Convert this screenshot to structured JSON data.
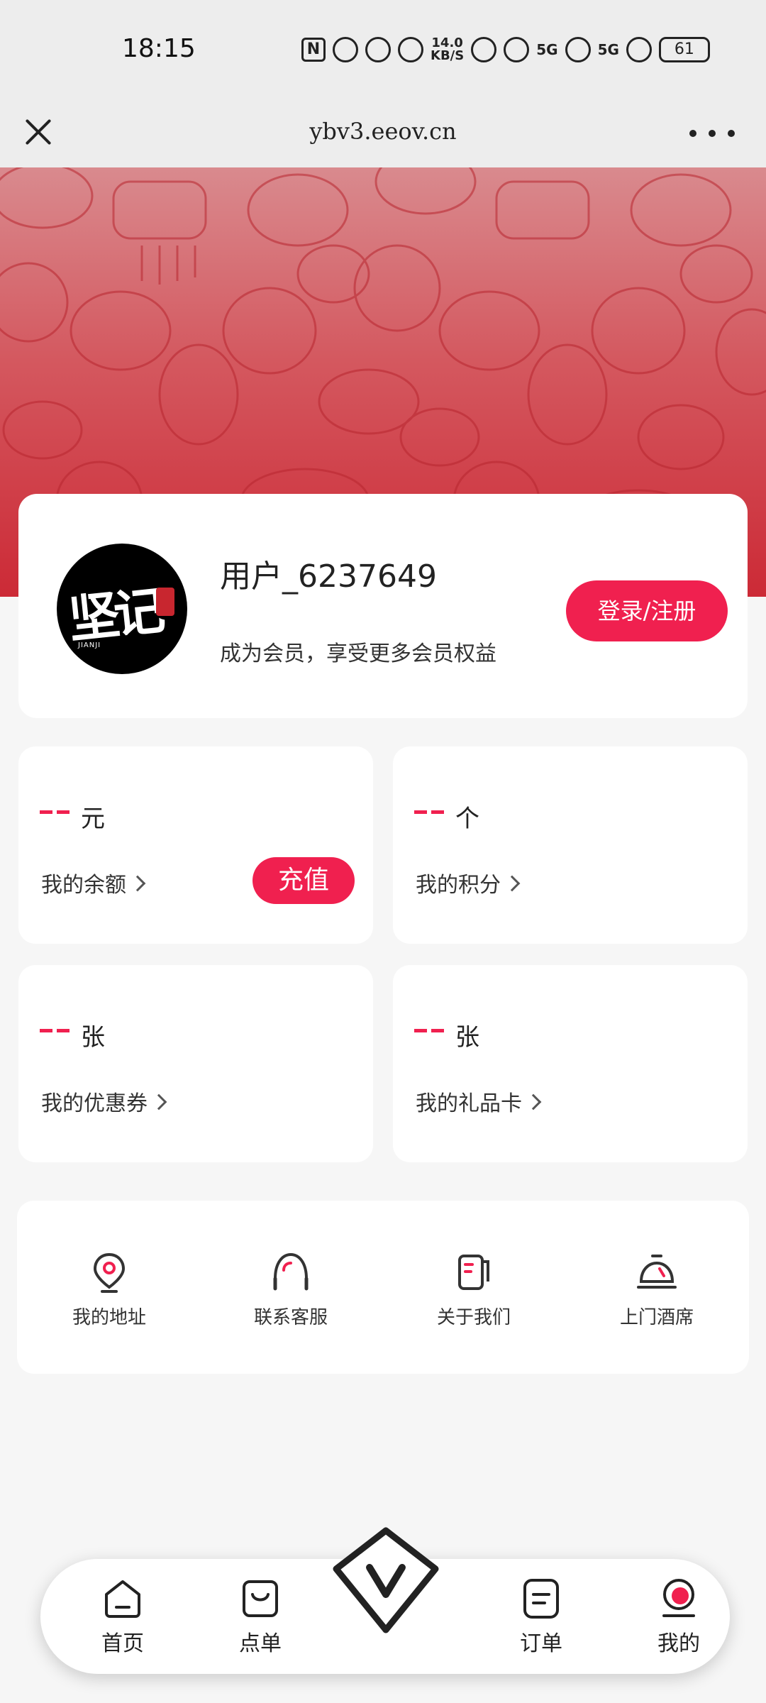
{
  "status_bar": {
    "time": "18:15",
    "net_speed_value": "14.0",
    "net_speed_unit": "KB/S",
    "signal_1": "5G",
    "signal_2": "5G",
    "battery": "61"
  },
  "title_bar": {
    "url": "ybv3.eeov.cn"
  },
  "profile": {
    "avatar_brand": "坚记",
    "avatar_sub": "JIANJI",
    "username": "用户_6237649",
    "member_hint": "成为会员，享受更多会员权益",
    "login_label": "登录/注册"
  },
  "stats": {
    "balance": {
      "unit": "元",
      "label": "我的余额",
      "action": "充值"
    },
    "points": {
      "unit": "个",
      "label": "我的积分"
    },
    "coupons": {
      "unit": "张",
      "label": "我的优惠券"
    },
    "giftcards": {
      "unit": "张",
      "label": "我的礼品卡"
    }
  },
  "services": [
    {
      "label": "我的地址",
      "icon": "location-pin-icon"
    },
    {
      "label": "联系客服",
      "icon": "headset-icon"
    },
    {
      "label": "关于我们",
      "icon": "cup-icon"
    },
    {
      "label": "上门酒席",
      "icon": "service-bell-icon"
    }
  ],
  "bottom_nav": [
    {
      "label": "首页",
      "icon": "home-icon"
    },
    {
      "label": "点单",
      "icon": "shopping-bag-icon"
    },
    {
      "label": "订单",
      "icon": "order-list-icon"
    },
    {
      "label": "我的",
      "icon": "profile-icon"
    }
  ],
  "colors": {
    "accent": "#f0204f",
    "banner": "#cc2a36",
    "background": "#f6f6f6"
  }
}
